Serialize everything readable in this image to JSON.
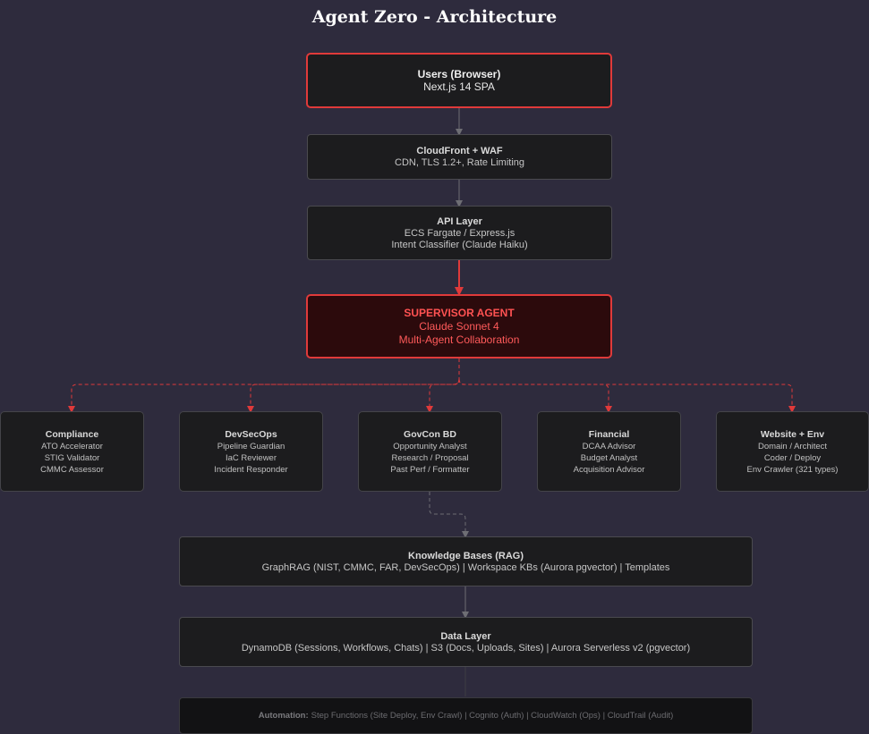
{
  "title": "Agent Zero - Architecture",
  "users": {
    "heading": "Users (Browser)",
    "line": "Next.js 14 SPA"
  },
  "cloudfront": {
    "heading": "CloudFront + WAF",
    "line": "CDN, TLS 1.2+, Rate Limiting"
  },
  "api": {
    "heading": "API Layer",
    "lines": [
      "ECS Fargate / Express.js",
      "Intent Classifier (Claude Haiku)"
    ]
  },
  "supervisor": {
    "heading": "SUPERVISOR AGENT",
    "lines": [
      "Claude Sonnet 4",
      "Multi-Agent Collaboration"
    ]
  },
  "agents": [
    {
      "name": "Compliance",
      "lines": [
        "ATO Accelerator",
        "STIG Validator",
        "CMMC Assessor"
      ]
    },
    {
      "name": "DevSecOps",
      "lines": [
        "Pipeline Guardian",
        "IaC Reviewer",
        "Incident Responder"
      ]
    },
    {
      "name": "GovCon BD",
      "lines": [
        "Opportunity Analyst",
        "Research / Proposal",
        "Past Perf / Formatter"
      ]
    },
    {
      "name": "Financial",
      "lines": [
        "DCAA Advisor",
        "Budget Analyst",
        "Acquisition Advisor"
      ]
    },
    {
      "name": "Website + Env",
      "lines": [
        "Domain / Architect",
        "Coder / Deploy",
        "Env Crawler (321 types)"
      ]
    }
  ],
  "knowledge": {
    "heading": "Knowledge Bases (RAG)",
    "line": "GraphRAG (NIST, CMMC, FAR, DevSecOps) | Workspace KBs (Aurora pgvector) | Templates"
  },
  "data_layer": {
    "heading": "Data Layer",
    "line": "DynamoDB (Sessions, Workflows, Chats) | S3 (Docs, Uploads, Sites) | Aurora Serverless v2 (pgvector)"
  },
  "automation": {
    "label": "Automation:",
    "text": "Step Functions (Site Deploy, Env Crawl) | Cognito (Auth) | CloudWatch (Ops) | CloudTrail (Audit)"
  },
  "colors": {
    "background": "#2e2b3d",
    "accent": "#e03a3a",
    "node": "#1c1c1e",
    "gray_arrow": "#6e6e74"
  }
}
